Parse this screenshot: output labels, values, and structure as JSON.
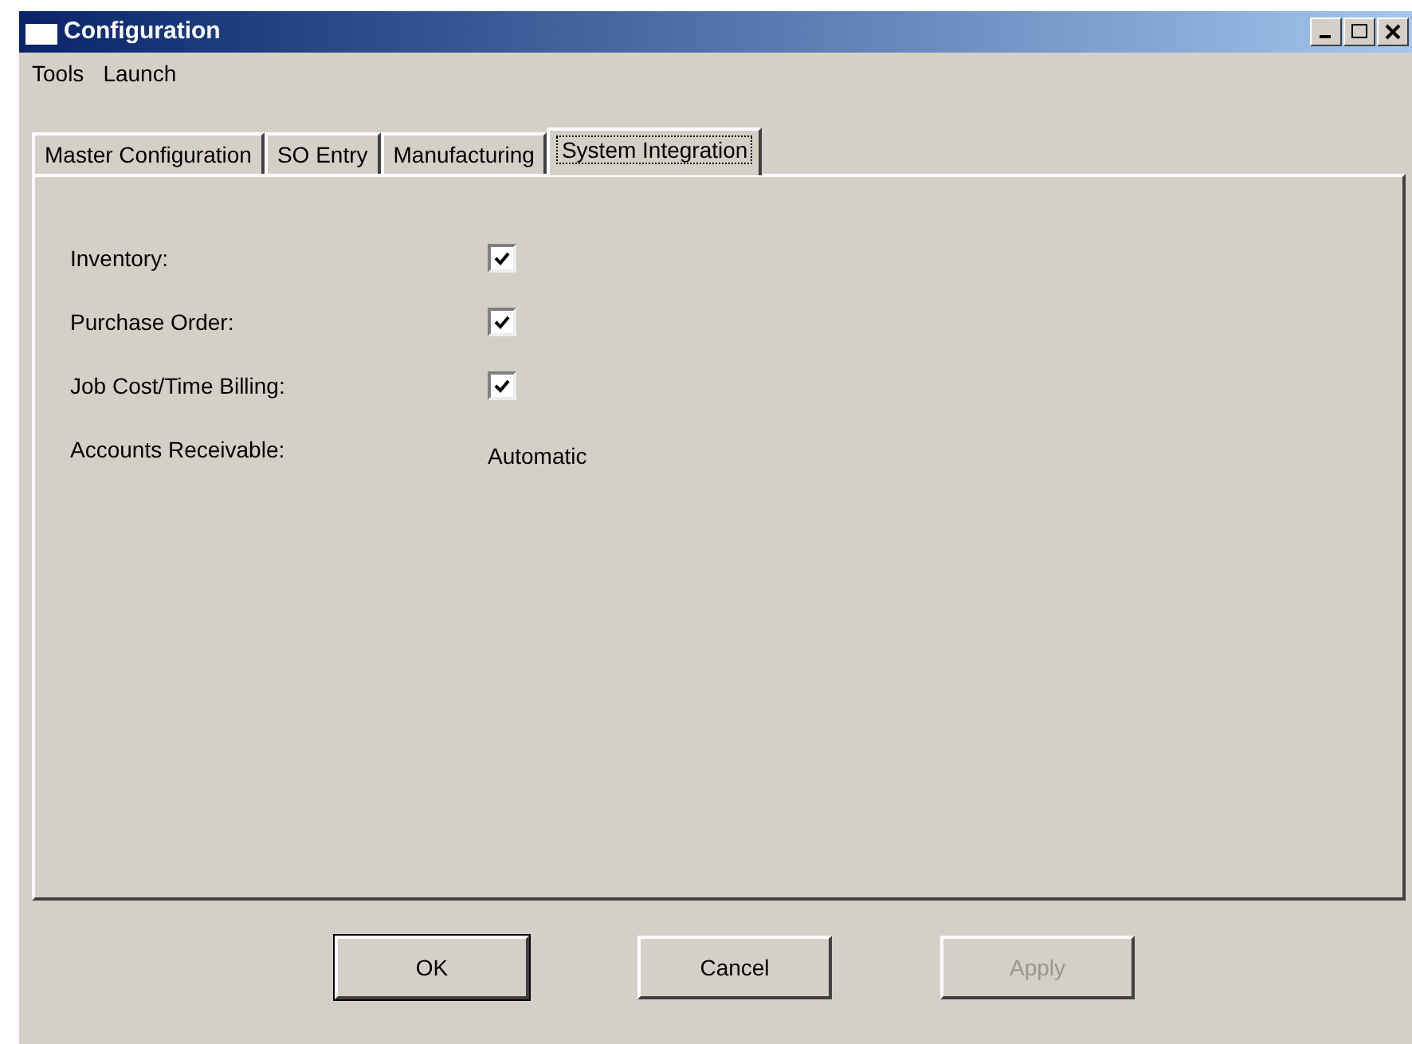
{
  "window": {
    "title": "Configuration"
  },
  "menu": [
    "Tools",
    "Launch"
  ],
  "tabs": [
    {
      "label": "Master Configuration",
      "selected": false
    },
    {
      "label": "SO Entry",
      "selected": false
    },
    {
      "label": "Manufacturing",
      "selected": false
    },
    {
      "label": "System Integration",
      "selected": true
    }
  ],
  "rows": [
    {
      "kind": "checkbox",
      "label": "Inventory:",
      "checked": true
    },
    {
      "kind": "checkbox",
      "label": "Purchase Order:",
      "checked": true
    },
    {
      "kind": "checkbox",
      "label": "Job Cost/Time Billing:",
      "checked": true
    },
    {
      "kind": "text",
      "label": "Accounts Receivable:",
      "value": "Automatic"
    }
  ],
  "buttons": [
    {
      "label": "OK",
      "default": true,
      "disabled": false
    },
    {
      "label": "Cancel",
      "default": false,
      "disabled": false
    },
    {
      "label": "Apply",
      "default": false,
      "disabled": true
    }
  ]
}
